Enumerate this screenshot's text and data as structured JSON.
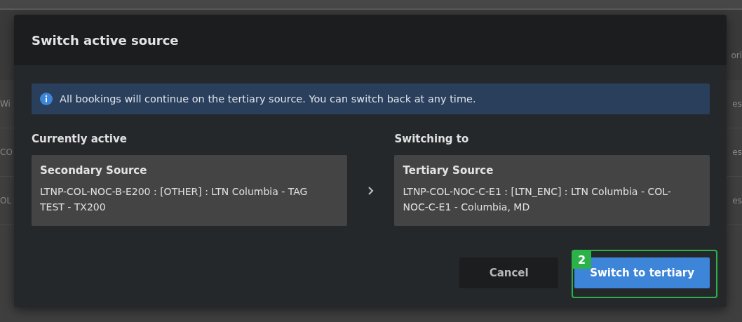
{
  "backdrop": {
    "header_fragment": "ori",
    "rows": [
      {
        "left": "Wi",
        "right": "es"
      },
      {
        "left": "CO",
        "right": "es"
      },
      {
        "left": "OL",
        "right": "es"
      }
    ]
  },
  "dialog": {
    "title": "Switch active source",
    "notice": "All bookings will continue on the tertiary source. You can switch back at any time.",
    "current": {
      "label": "Currently active",
      "name": "Secondary Source",
      "detail": "LTNP-COL-NOC-B-E200 : [OTHER] : LTN Columbia - TAG TEST - TX200"
    },
    "target": {
      "label": "Switching to",
      "name": "Tertiary Source",
      "detail": "LTNP-COL-NOC-C-E1 : [LTN_ENC] : LTN Columbia - COL-NOC-C-E1 - Columbia, MD"
    },
    "buttons": [
      {
        "label": "Cancel",
        "kind": "secondary"
      },
      {
        "label": "Switch to tertiary",
        "kind": "primary",
        "highlight": "2"
      }
    ]
  }
}
